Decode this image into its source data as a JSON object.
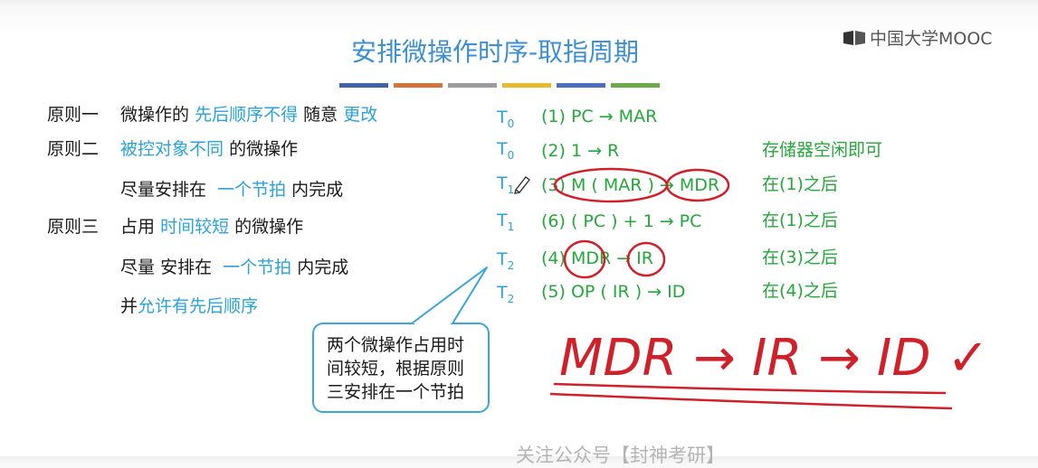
{
  "logo": {
    "text": "中国大学MOOC"
  },
  "title": "安排微操作时序-取指周期",
  "principles": {
    "p1": {
      "label": "原则一",
      "a": "微操作的",
      "b": "先后顺序不得",
      "c": "随意",
      "d": "更改"
    },
    "p2": {
      "label": "原则二",
      "a": "被控对象不同",
      "b": "的微操作",
      "c": "尽量安排在",
      "d": "一个节拍",
      "e": "内完成"
    },
    "p3": {
      "label": "原则三",
      "a": "占用",
      "b": "时间较短",
      "c": "的微操作",
      "d": "尽量",
      "e": "安排在",
      "f": "一个节拍",
      "g": "内完成",
      "h": "并",
      "i": "允许有先后顺序"
    }
  },
  "ops": [
    {
      "t": "T",
      "sub": "0",
      "op": "(1) PC → MAR",
      "note": ""
    },
    {
      "t": "T",
      "sub": "0",
      "op": "(2) 1 → R",
      "note": "存储器空闲即可"
    },
    {
      "t": "T",
      "sub": "1",
      "op": "(3) M ( MAR ) → MDR",
      "note": "在(1)之后"
    },
    {
      "t": "T",
      "sub": "1",
      "op": "(6) ( PC ) + 1 → PC",
      "note": "在(1)之后"
    },
    {
      "t": "T",
      "sub": "2",
      "op": "(4) MDR → IR",
      "note": "在(3)之后"
    },
    {
      "t": "T",
      "sub": "2",
      "op": "(5) OP ( IR ) → ID",
      "note": "在(4)之后"
    }
  ],
  "callout": {
    "line1": "两个微操作占用时",
    "line2": "间较短，根据原则",
    "line3": "三安排在一个节拍"
  },
  "handwriting": {
    "text": "MDR → IR → ID ✓"
  },
  "footer": {
    "text": "关注公众号【封神考研】"
  },
  "colors": {
    "title": "#3c8fd0",
    "cyan": "#2aa3db",
    "green": "#24a83a",
    "ink": "#d0202a"
  }
}
